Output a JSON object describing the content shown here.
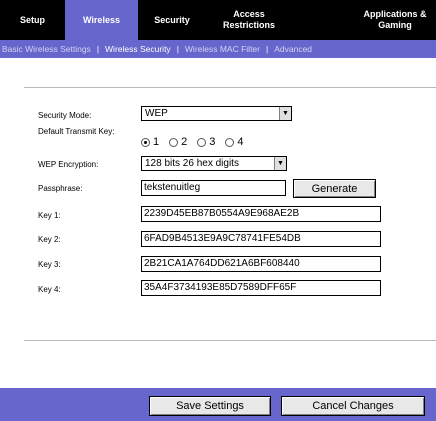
{
  "nav": {
    "tabs": [
      {
        "label": "Setup"
      },
      {
        "label": "Wireless"
      },
      {
        "label": "Security"
      },
      {
        "label": "Access Restrictions"
      },
      {
        "label": "Applications & Gaming"
      }
    ],
    "active_tab": "Wireless"
  },
  "subnav": {
    "items": [
      {
        "label": "Basic Wireless Settings"
      },
      {
        "label": "Wireless Security"
      },
      {
        "label": "Wireless MAC Filter"
      },
      {
        "label": "Advanced"
      }
    ],
    "separator": "|",
    "active_item": "Wireless Security"
  },
  "form": {
    "security_mode": {
      "label": "Security Mode:",
      "value": "WEP"
    },
    "default_key": {
      "label": "Default Transmit Key:",
      "options": [
        "1",
        "2",
        "3",
        "4"
      ],
      "selected": "1"
    },
    "wep_encryption": {
      "label": "WEP Encryption:",
      "value": "128 bits 26 hex digits"
    },
    "passphrase": {
      "label": "Passphrase:",
      "value": "tekstenuitleg",
      "button": "Generate"
    },
    "keys": [
      {
        "label": "Key 1:",
        "value": "2239D45EB87B0554A9E968AE2B"
      },
      {
        "label": "Key 2:",
        "value": "6FAD9B4513E9A9C78741FE54DB"
      },
      {
        "label": "Key 3:",
        "value": "2B21CA1A764DD621A6BF608440"
      },
      {
        "label": "Key 4:",
        "value": "35A4F3734193E85D7589DFF65F"
      }
    ]
  },
  "footer": {
    "save_label": "Save Settings",
    "cancel_label": "Cancel Changes"
  },
  "colors": {
    "nav_bg": "#000000",
    "accent": "#6666cc",
    "text": "#000000"
  }
}
